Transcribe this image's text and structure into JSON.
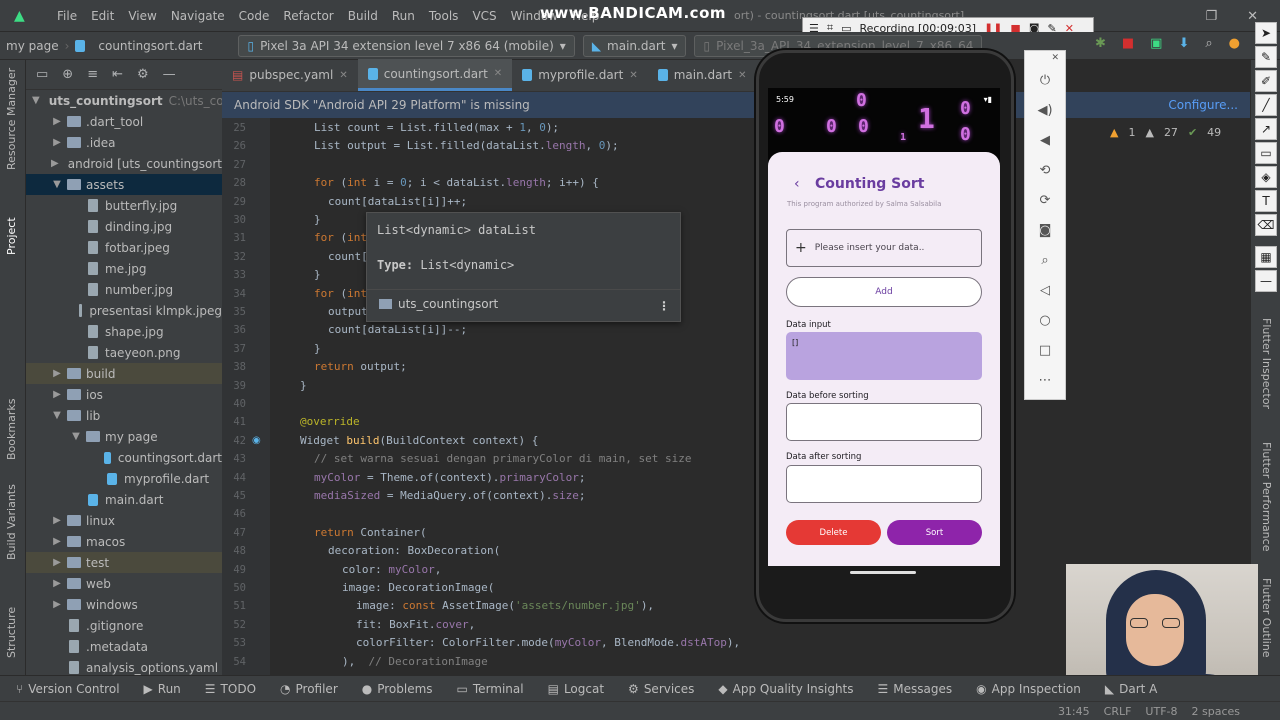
{
  "menubar": {
    "items": [
      "File",
      "Edit",
      "View",
      "Navigate",
      "Code",
      "Refactor",
      "Build",
      "Run",
      "Tools",
      "VCS",
      "Window",
      "Help"
    ],
    "overlay_logo": "www.BANDICAM.com",
    "title_fragment": "ort) - countingsort.dart [uts_countingsort]",
    "recording": {
      "label": "Recording [00:09:03]"
    }
  },
  "toolbar": {
    "breadcrumb1": "my page",
    "breadcrumb2": "countingsort.dart",
    "device": "Pixel 3a API 34 extension level 7 x86 64 (mobile)",
    "run_config": "main.dart",
    "device2": "Pixel_3a_API_34_extension_level_7_x86_64"
  },
  "left_tabs": [
    "Resource Manager",
    "Project",
    "Bookmarks",
    "Build Variants",
    "Structure"
  ],
  "project": {
    "root_label": "uts_countingsort",
    "root_path": "C:\\uts_coun",
    "items": [
      {
        "label": "uts_countingsort",
        "depth": 0,
        "type": "folder",
        "open": true
      },
      {
        "label": ".dart_tool",
        "depth": 1,
        "type": "folder",
        "open": false
      },
      {
        "label": ".idea",
        "depth": 1,
        "type": "folder",
        "open": false
      },
      {
        "label": "android [uts_countingsort",
        "depth": 1,
        "type": "folder",
        "open": false
      },
      {
        "label": "assets",
        "depth": 1,
        "type": "folder",
        "open": true
      },
      {
        "label": "butterfly.jpg",
        "depth": 2,
        "type": "file"
      },
      {
        "label": "dinding.jpg",
        "depth": 2,
        "type": "file"
      },
      {
        "label": "fotbar.jpeg",
        "depth": 2,
        "type": "file"
      },
      {
        "label": "me.jpg",
        "depth": 2,
        "type": "file"
      },
      {
        "label": "number.jpg",
        "depth": 2,
        "type": "file"
      },
      {
        "label": "presentasi klmpk.jpeg",
        "depth": 2,
        "type": "file"
      },
      {
        "label": "shape.jpg",
        "depth": 2,
        "type": "file"
      },
      {
        "label": "taeyeon.png",
        "depth": 2,
        "type": "file"
      },
      {
        "label": "build",
        "depth": 1,
        "type": "folder",
        "open": false
      },
      {
        "label": "ios",
        "depth": 1,
        "type": "folder",
        "open": false
      },
      {
        "label": "lib",
        "depth": 1,
        "type": "folder",
        "open": true
      },
      {
        "label": "my page",
        "depth": 2,
        "type": "folder",
        "open": true
      },
      {
        "label": "countingsort.dart",
        "depth": 3,
        "type": "dart"
      },
      {
        "label": "myprofile.dart",
        "depth": 3,
        "type": "dart"
      },
      {
        "label": "main.dart",
        "depth": 2,
        "type": "dart"
      },
      {
        "label": "linux",
        "depth": 1,
        "type": "folder",
        "open": false
      },
      {
        "label": "macos",
        "depth": 1,
        "type": "folder",
        "open": false
      },
      {
        "label": "test",
        "depth": 1,
        "type": "folder",
        "open": false
      },
      {
        "label": "web",
        "depth": 1,
        "type": "folder",
        "open": false
      },
      {
        "label": "windows",
        "depth": 1,
        "type": "folder",
        "open": false
      },
      {
        "label": ".gitignore",
        "depth": 1,
        "type": "file"
      },
      {
        "label": ".metadata",
        "depth": 1,
        "type": "file"
      },
      {
        "label": "analysis_options.yaml",
        "depth": 1,
        "type": "file"
      }
    ]
  },
  "tabs": [
    "pubspec.yaml",
    "countingsort.dart",
    "myprofile.dart",
    "main.dart"
  ],
  "active_tab": "countingsort.dart",
  "banner": {
    "message": "Android SDK \"Android API 29 Platform\" is missing",
    "action": "Configure..."
  },
  "inspections": {
    "warnings": "1",
    "weak": "27",
    "ok": "49"
  },
  "code": {
    "line_numbers": [
      "25",
      "26",
      "27",
      "28",
      "29",
      "30",
      "31",
      "32",
      "33",
      "34",
      "35",
      "36",
      "37",
      "38",
      "39",
      "40",
      "41",
      "42",
      "43",
      "44",
      "45",
      "46",
      "47",
      "48",
      "49",
      "50",
      "51",
      "52",
      "53",
      "54"
    ],
    "lines": [
      "List count = List.filled(max + 1, 0);",
      "List output = List.filled(dataList.length, 0);",
      "",
      "for (int i = 0; i < dataList.length; i++) {",
      "  count[dataList[i]]++;",
      "}",
      "for (int",
      "  count[",
      "}",
      "for (int",
      "  output",
      "  count[dataList[i]]--;",
      "}",
      "return output;",
      "}",
      "",
      "@override",
      "Widget build(BuildContext context) {",
      "  // set warna sesuai dengan primaryColor di main, set size",
      "  myColor = Theme.of(context).primaryColor;",
      "  mediaSized = MediaQuery.of(context).size;",
      "",
      "  return Container(",
      "    decoration: BoxDecoration(",
      "      color: myColor,",
      "      image: DecorationImage(",
      "        image: const AssetImage('assets/number.jpg'),",
      "        fit: BoxFit.cover,",
      "        colorFilter: ColorFilter.mode(myColor, BlendMode.dstATop),",
      "      ),  // DecorationImage"
    ]
  },
  "popup": {
    "signature": "List<dynamic> dataList",
    "type_label": "Type:",
    "type_value": "List<dynamic>",
    "module": "uts_countingsort"
  },
  "right_tabs": [
    "Flutter Inspector",
    "Flutter Performance",
    "Flutter Outline"
  ],
  "bottom_tools": [
    "Version Control",
    "Run",
    "TODO",
    "Profiler",
    "Problems",
    "Terminal",
    "Logcat",
    "Services",
    "App Quality Insights",
    "Messages",
    "App Inspection",
    "Dart A"
  ],
  "statusbar": {
    "position": "31:45",
    "line_sep": "CRLF",
    "encoding": "UTF-8",
    "indent": "2 spaces"
  },
  "app": {
    "status_time": "5:59",
    "title": "Counting Sort",
    "subtitle": "This program authorized by Salma Salsabila",
    "input_placeholder": "Please insert your data..",
    "add_label": "Add",
    "data_input_label": "Data input",
    "data_input_value": "[]",
    "before_label": "Data before sorting",
    "after_label": "Data after sorting",
    "delete_label": "Delete",
    "sort_label": "Sort"
  },
  "colors": {
    "accent": "#4a88c7",
    "app_primary": "#6a3da0",
    "delete": "#e53935",
    "sort": "#8e24aa",
    "data_box": "#b9a3df"
  }
}
